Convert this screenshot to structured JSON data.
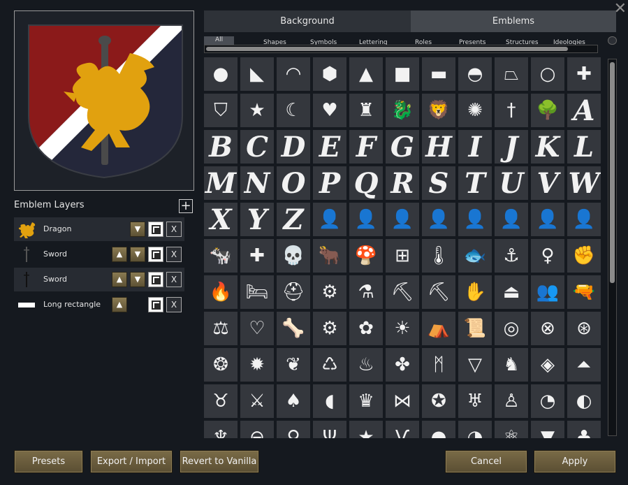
{
  "tabs": {
    "background": "Background",
    "emblems": "Emblems"
  },
  "categories": [
    "All",
    "Shapes",
    "Symbols",
    "Lettering",
    "Roles",
    "Presents",
    "Structures",
    "Ideologies"
  ],
  "layers_title": "Emblem Layers",
  "add_layer_label": "+",
  "layers": [
    {
      "name": "Dragon",
      "icon": "dragon-icon"
    },
    {
      "name": "Sword",
      "icon": "sword-icon"
    },
    {
      "name": "Sword",
      "icon": "sword-icon"
    },
    {
      "name": "Long rectangle",
      "icon": "rectangle-icon"
    }
  ],
  "layer_controls": {
    "up": "▲",
    "down": "▼",
    "delete": "X"
  },
  "close_label": "✕",
  "shield_colors": {
    "left": "#8b1a1a",
    "right": "#24273a",
    "stripe": "#ffffff",
    "emblem": "#e1a10f",
    "sword": "#4a4a4a"
  },
  "emblems": [
    "●",
    "◣",
    "◠",
    "⬢",
    "▲",
    "■",
    "▬",
    "◓",
    "⏢",
    "○",
    "✚",
    "⛉",
    "★",
    "☾",
    "♥",
    "♜",
    "🐉",
    "🦁",
    "✺",
    "†",
    "🌳",
    "A",
    "B",
    "C",
    "D",
    "E",
    "F",
    "G",
    "H",
    "I",
    "J",
    "K",
    "L",
    "M",
    "N",
    "O",
    "P",
    "Q",
    "R",
    "S",
    "T",
    "U",
    "V",
    "W",
    "X",
    "Y",
    "Z",
    "👤",
    "👤",
    "👤",
    "👤",
    "👤",
    "👤",
    "👤",
    "👤",
    "🐄",
    "✚",
    "💀",
    "🐂",
    "🍄",
    "⊞",
    "🌡",
    "🐟",
    "⚓",
    "♀",
    "✊",
    "🔥",
    "🛏",
    "⛑",
    "⚙",
    "⚗",
    "⛏",
    "⛏",
    "✋",
    "⏏",
    "👥",
    "🔫",
    "⚖",
    "♡",
    "🦴",
    "⚙",
    "✿",
    "☀",
    "⛺",
    "📜",
    "◎",
    "⊗",
    "⊛",
    "❂",
    "✹",
    "❦",
    "♺",
    "♨",
    "✤",
    "ᛗ",
    "▽",
    "♞",
    "◈",
    "⏶",
    "♉",
    "⚔",
    "♠",
    "◖",
    "♛",
    "⋈",
    "✪",
    "♅",
    "♙",
    "◔",
    "◐",
    "♆",
    "⊖",
    "⚲",
    "Ψ",
    "★",
    "Ѵ",
    "◓",
    "◔",
    "⚛",
    "▼",
    "♣"
  ],
  "letters": [
    "A",
    "B",
    "C",
    "D",
    "E",
    "F",
    "G",
    "H",
    "I",
    "J",
    "K",
    "L",
    "M",
    "N",
    "O",
    "P",
    "Q",
    "R",
    "S",
    "T",
    "U",
    "V",
    "W",
    "X",
    "Y",
    "Z"
  ],
  "buttons": {
    "presets": "Presets",
    "export_import": "Export / Import",
    "revert": "Revert to Vanilla",
    "cancel": "Cancel",
    "apply": "Apply"
  }
}
